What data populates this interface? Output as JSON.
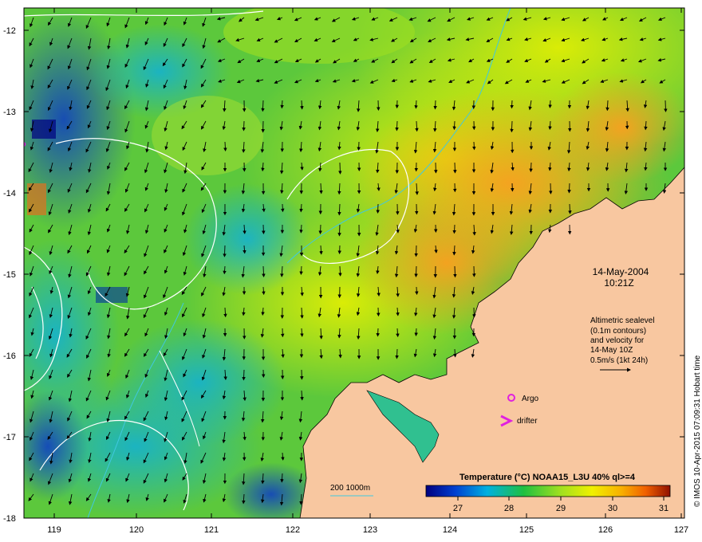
{
  "map": {
    "lon_ticks": [
      "119",
      "120",
      "121",
      "122",
      "123",
      "124",
      "125",
      "126",
      "127"
    ],
    "lat_ticks": [
      "-12",
      "-13",
      "-14",
      "-15",
      "-16",
      "-17",
      "-18"
    ],
    "lon_range": [
      118.6,
      127.0
    ],
    "lat_range": [
      -18.0,
      -11.8
    ]
  },
  "annotations": {
    "date": "14-May-2004",
    "time": "10:21Z",
    "legend_block": {
      "line1": "Altimetric sealevel",
      "line2": "(0.1m contours)",
      "line3": "and velocity for",
      "line4": "14-May 10Z",
      "line5": "0.5m/s (1kt 24h)"
    },
    "argo_label": "Argo",
    "drifter_label": "drifter",
    "bathy_label": "200  1000m",
    "credit": "© IMOS 10-Apr-2015 07:09:31 Hobart time"
  },
  "colorbar": {
    "title": "Temperature (°C) NOAA15_L3U 40% ql>=4",
    "ticks": [
      "27",
      "28",
      "29",
      "30",
      "31"
    ],
    "range": [
      26.5,
      31.3
    ]
  },
  "colors": {
    "land": "#f8c7a0",
    "argo": "#e020e0",
    "drifter": "#e020e0",
    "contour": "#ffffff",
    "bathy": "#40c8e0"
  }
}
